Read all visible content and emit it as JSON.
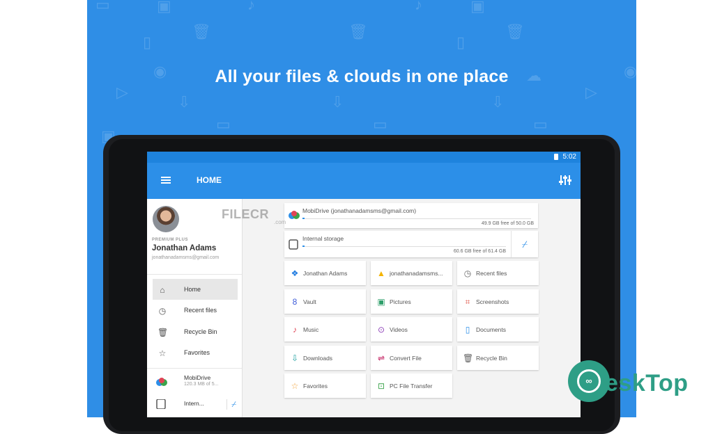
{
  "headline": "All your files & clouds in one place",
  "status": {
    "time": "5:02"
  },
  "appbar": {
    "title": "HOME"
  },
  "drawer": {
    "tier": "PREMIUM PLUS",
    "name": "Jonathan Adams",
    "email": "jonathanadamsms@gmail.com",
    "items": [
      {
        "label": "Home",
        "icon": "home-icon"
      },
      {
        "label": "Recent files",
        "icon": "clock-icon"
      },
      {
        "label": "Recycle Bin",
        "icon": "trash-icon"
      },
      {
        "label": "Favorites",
        "icon": "star-icon"
      }
    ],
    "storage": [
      {
        "name": "MobiDrive",
        "sub": "120.3 MB of 5...",
        "icon": "cloud-icon"
      },
      {
        "name": "Intern...",
        "sub": "",
        "icon": "tablet-icon"
      }
    ]
  },
  "storage_cards": [
    {
      "name": "MobiDrive (jonathanadamsms@gmail.com)",
      "free": "49.9 GB free of 50.0 GB",
      "used_fraction": 0.01
    },
    {
      "name": "Internal storage",
      "free": "60.6 GB free of 61.4 GB",
      "used_fraction": 0.01
    }
  ],
  "tiles": [
    {
      "label": "Jonathan Adams",
      "icon": "dropbox-icon",
      "color": "#1e7be0"
    },
    {
      "label": "jonathanadamsms...",
      "icon": "google-drive-icon",
      "color": "#f4b400"
    },
    {
      "label": "Recent files",
      "icon": "clock-icon",
      "color": "#666666"
    },
    {
      "label": "Vault",
      "icon": "lock-icon",
      "color": "#3d5bd8"
    },
    {
      "label": "Pictures",
      "icon": "image-icon",
      "color": "#2e9e6a"
    },
    {
      "label": "Screenshots",
      "icon": "screenshot-icon",
      "color": "#e05a4e"
    },
    {
      "label": "Music",
      "icon": "music-icon",
      "color": "#e04455"
    },
    {
      "label": "Videos",
      "icon": "video-icon",
      "color": "#8d3fb8"
    },
    {
      "label": "Documents",
      "icon": "document-icon",
      "color": "#2c8fe8"
    },
    {
      "label": "Downloads",
      "icon": "download-icon",
      "color": "#1fa0a0"
    },
    {
      "label": "Convert File",
      "icon": "convert-icon",
      "color": "#c2185b"
    },
    {
      "label": "Recycle Bin",
      "icon": "trash-icon",
      "color": "#666666"
    },
    {
      "label": "Favorites",
      "icon": "star-icon",
      "color": "#f2a33a"
    },
    {
      "label": "PC File Transfer",
      "icon": "pc-transfer-icon",
      "color": "#3aa34a"
    }
  ],
  "watermark": {
    "text": "FILECR",
    "sub": ".com"
  },
  "brand": {
    "text": "esk",
    "text2": "Top",
    "color": "#2e9e86"
  }
}
